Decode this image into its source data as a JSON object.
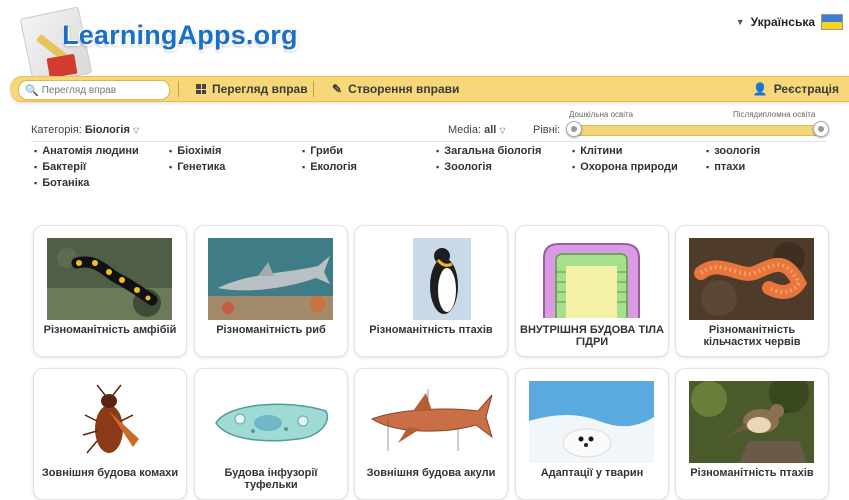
{
  "header": {
    "logo_text": "LearningApps.org",
    "language": "Українська"
  },
  "nav": {
    "search_placeholder": "Перегляд вправ",
    "browse_label": "Перегляд вправ",
    "create_label": "Створення вправи",
    "register_label": "Реєстрація"
  },
  "filters": {
    "category_label": "Категорія:",
    "category_value": "Біологія",
    "media_label": "Media:",
    "media_value": "all",
    "levels_label": "Рівні:",
    "level_min_label": "Дошкільна освіта",
    "level_max_label": "Післядипломна освіта"
  },
  "categories": [
    "Анатомія людини",
    "Біохімія",
    "Гриби",
    "Загальна біологія",
    "Клітини",
    "зоологія",
    "Бактерії",
    "Генетика",
    "Екологія",
    "Зоологія",
    "Охорона природи",
    "птахи",
    "Ботаніка"
  ],
  "cards": [
    {
      "title": "Різноманітність амфібій"
    },
    {
      "title": "Різноманітність риб"
    },
    {
      "title": "Різноманітність птахів"
    },
    {
      "title": "ВНУТРІШНЯ БУДОВА ТІЛА ГІДРИ"
    },
    {
      "title": "Різноманітність кільчастих червів"
    },
    {
      "title": "Зовнішня будова комахи"
    },
    {
      "title": "Будова інфузорії туфельки"
    },
    {
      "title": "Зовнішня будова акули"
    },
    {
      "title": "Адаптації у тварин"
    },
    {
      "title": "Різноманітність птахів"
    }
  ],
  "colors": {
    "nav_bg": "#f6d87a",
    "logo_blue": "#1a6fc9"
  }
}
